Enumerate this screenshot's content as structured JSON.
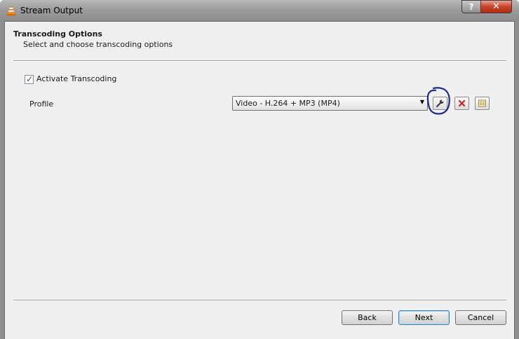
{
  "window": {
    "title": "Stream Output",
    "help_label": "?",
    "close_label": "✕"
  },
  "header": {
    "title": "Transcoding Options",
    "subtitle": "Select and choose transcoding options"
  },
  "transcoding": {
    "activate_label": "Activate Transcoding",
    "activate_checked": true,
    "check_glyph": "✓",
    "profile_label": "Profile",
    "profile_selected": "Video - H.264 + MP3 (MP4)"
  },
  "profile_buttons": [
    {
      "name": "edit-profile",
      "icon": "wrench-icon"
    },
    {
      "name": "delete-profile",
      "icon": "red-x-icon"
    },
    {
      "name": "new-profile",
      "icon": "new-profile-icon"
    }
  ],
  "footer": {
    "back_label": "Back",
    "next_label": "Next",
    "cancel_label": "Cancel"
  },
  "colors": {
    "annotation": "#1f2a8c",
    "delete_icon": "#d42020"
  }
}
